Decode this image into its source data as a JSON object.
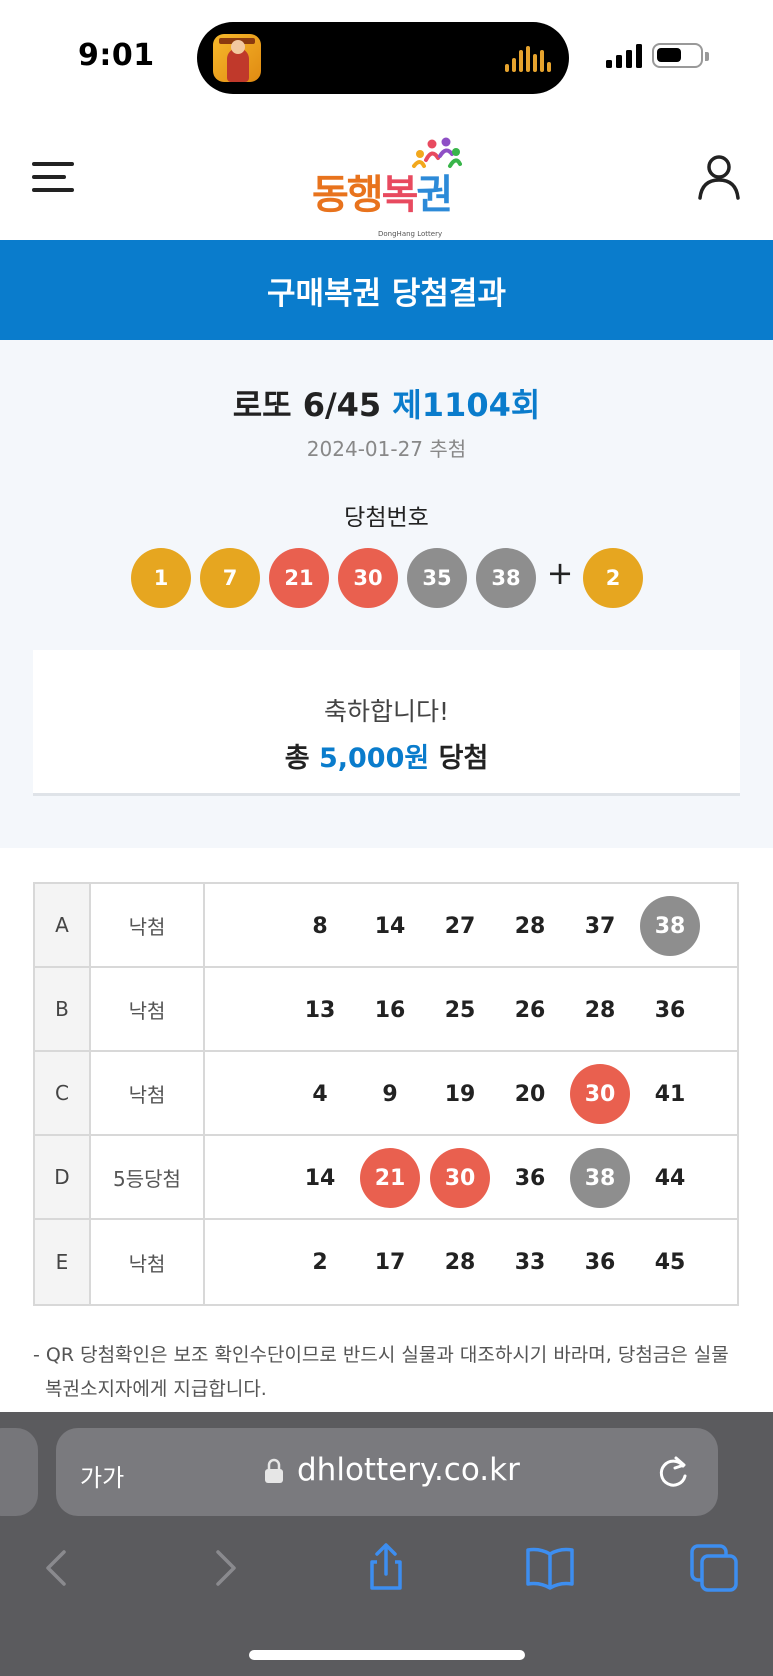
{
  "status_bar": {
    "time": "9:01"
  },
  "header": {
    "logo": {
      "part1": "동행",
      "part2": "복",
      "part3": "권",
      "sub": "DongHang Lottery"
    }
  },
  "page_title": "구매복권 당첨결과",
  "result": {
    "game_name": "로또 6/45",
    "round": "제1104회",
    "draw_date": "2024-01-27 추첨",
    "win_label": "당첨번호",
    "winning_numbers": [
      {
        "value": "1",
        "color": "yellow"
      },
      {
        "value": "7",
        "color": "yellow"
      },
      {
        "value": "21",
        "color": "red"
      },
      {
        "value": "30",
        "color": "red"
      },
      {
        "value": "35",
        "color": "gray"
      },
      {
        "value": "38",
        "color": "gray"
      }
    ],
    "plus": "+",
    "bonus_number": {
      "value": "2",
      "color": "yellow"
    },
    "congrats_line": "축하합니다!",
    "total_prefix": "총",
    "total_amount": "5,000원",
    "total_suffix": "당첨"
  },
  "tickets": [
    {
      "label": "A",
      "result": "낙첨",
      "numbers": [
        {
          "value": "8"
        },
        {
          "value": "14"
        },
        {
          "value": "27"
        },
        {
          "value": "28"
        },
        {
          "value": "37"
        },
        {
          "value": "38",
          "highlight": "gray"
        }
      ]
    },
    {
      "label": "B",
      "result": "낙첨",
      "numbers": [
        {
          "value": "13"
        },
        {
          "value": "16"
        },
        {
          "value": "25"
        },
        {
          "value": "26"
        },
        {
          "value": "28"
        },
        {
          "value": "36"
        }
      ]
    },
    {
      "label": "C",
      "result": "낙첨",
      "numbers": [
        {
          "value": "4"
        },
        {
          "value": "9"
        },
        {
          "value": "19"
        },
        {
          "value": "20"
        },
        {
          "value": "30",
          "highlight": "red"
        },
        {
          "value": "41"
        }
      ]
    },
    {
      "label": "D",
      "result": "5등당첨",
      "numbers": [
        {
          "value": "14"
        },
        {
          "value": "21",
          "highlight": "red"
        },
        {
          "value": "30",
          "highlight": "red"
        },
        {
          "value": "36"
        },
        {
          "value": "38",
          "highlight": "gray"
        },
        {
          "value": "44"
        }
      ]
    },
    {
      "label": "E",
      "result": "낙첨",
      "numbers": [
        {
          "value": "2"
        },
        {
          "value": "17"
        },
        {
          "value": "28"
        },
        {
          "value": "33"
        },
        {
          "value": "36"
        },
        {
          "value": "45"
        }
      ]
    }
  ],
  "note": "- QR 당첨확인은 보조 확인수단이므로 반드시 실물과 대조하시기 바라며, 당첨금은 실물 복권소지자에게 지급합니다.",
  "browser": {
    "text_size_label": "가가",
    "url": "dhlottery.co.kr"
  },
  "colors": {
    "brand_blue": "#0a7ccc",
    "ball_yellow": "#e6a620",
    "ball_red": "#e9604f",
    "ball_gray": "#8e8e8e"
  },
  "icons": {
    "menu": "hamburger-menu-icon",
    "user": "user-profile-icon",
    "lock": "lock-icon",
    "reload": "reload-icon",
    "back": "chevron-left-icon",
    "forward": "chevron-right-icon",
    "share": "share-icon",
    "bookmarks": "book-icon",
    "tabs": "tabs-icon"
  }
}
